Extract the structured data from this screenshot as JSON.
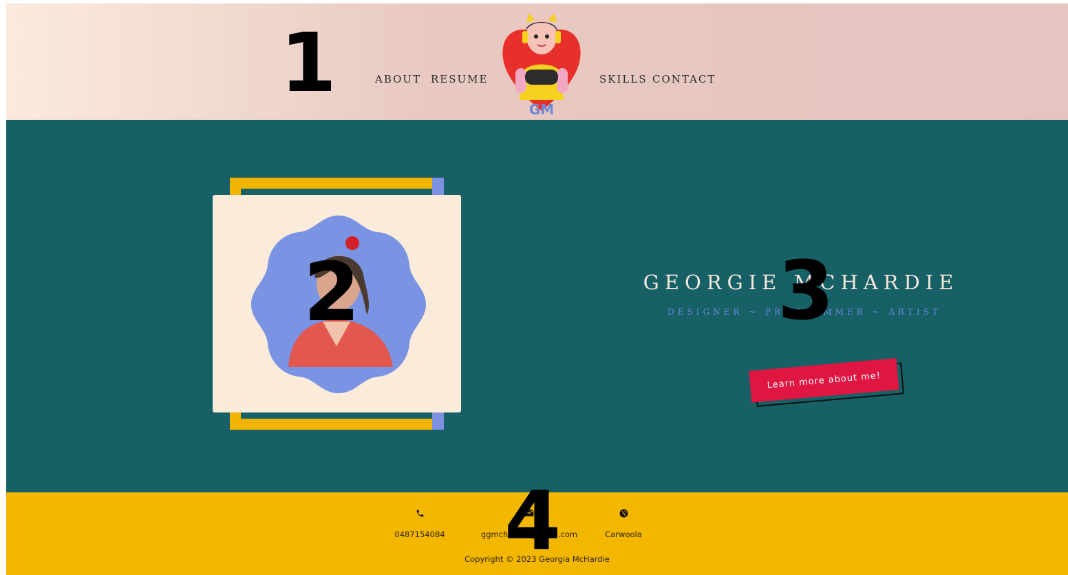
{
  "header": {
    "nav_left": [
      "ABOUT",
      "RESUME"
    ],
    "nav_right": [
      "SKILLS",
      "CONTACT"
    ],
    "logo_text": "GM"
  },
  "hero": {
    "name": "GEORGIE MCHARDIE",
    "tagline": "DESIGNER ~ PROGRAMMER ~ ARTIST",
    "cta_label": "Learn more about me!"
  },
  "footer": {
    "phone": "0487154084",
    "email": "ggmchardie@gmail.com",
    "location": "Carwoola",
    "copyright": "Copyright © 2023 Georgia McHardie"
  },
  "markers": [
    "1",
    "2",
    "3",
    "4"
  ],
  "colors": {
    "header_bg": "#e6c8c1",
    "hero_bg": "#176066",
    "footer_bg": "#f4b700",
    "accent_red": "#de1641",
    "accent_blue": "#7d91e0",
    "accent_gold": "#f2b400"
  },
  "icons": {
    "phone": "phone-icon",
    "email": "envelope-icon",
    "location": "globe-icon"
  }
}
